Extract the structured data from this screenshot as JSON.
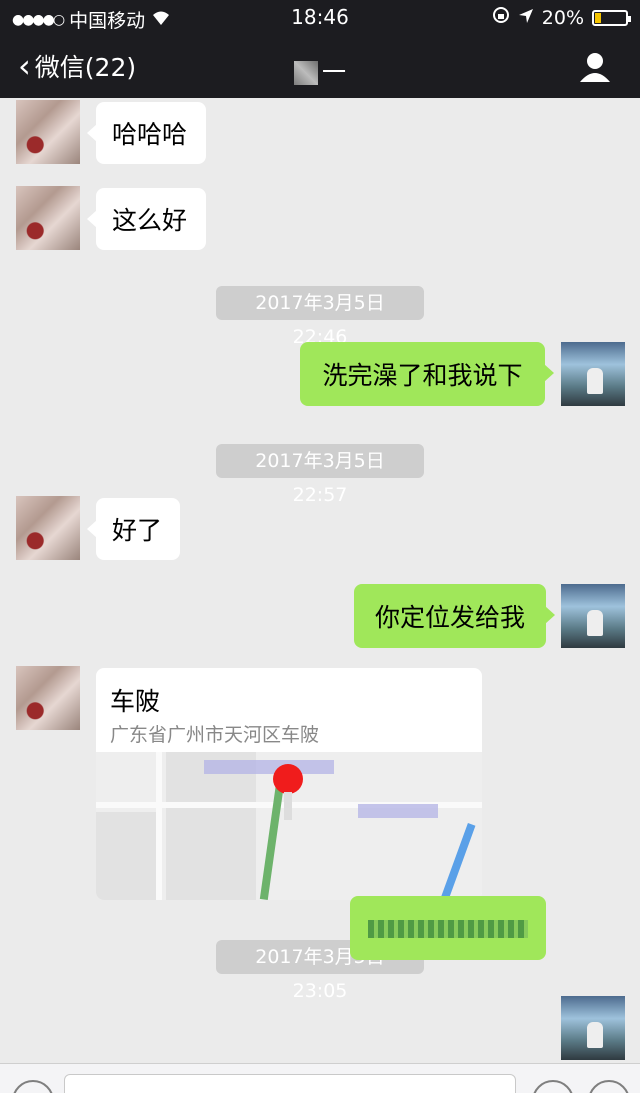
{
  "status_bar": {
    "signal": "●●●●○",
    "carrier": "中国移动",
    "time": "18:46",
    "battery": "20%"
  },
  "nav": {
    "back_label": "微信(22)",
    "title": "一"
  },
  "messages": [
    {
      "side": "in",
      "text": "哈哈哈"
    },
    {
      "side": "in",
      "text": "这么好"
    },
    {
      "timestamp": "2017年3月5日 22:46"
    },
    {
      "side": "out",
      "text": "洗完澡了和我说下"
    },
    {
      "timestamp": "2017年3月5日 22:57"
    },
    {
      "side": "in",
      "text": "好了"
    },
    {
      "side": "out",
      "text": "你定位发给我"
    },
    {
      "side": "in",
      "type": "location",
      "name": "车陂",
      "address": "广东省广州市天河区车陂"
    },
    {
      "timestamp": "2017年3月5日 23:05"
    }
  ],
  "colors": {
    "outgoing_bubble": "#a0e75a",
    "incoming_bubble": "#ffffff",
    "topbar": "#1c1c20",
    "chat_bg": "#ebebeb"
  }
}
